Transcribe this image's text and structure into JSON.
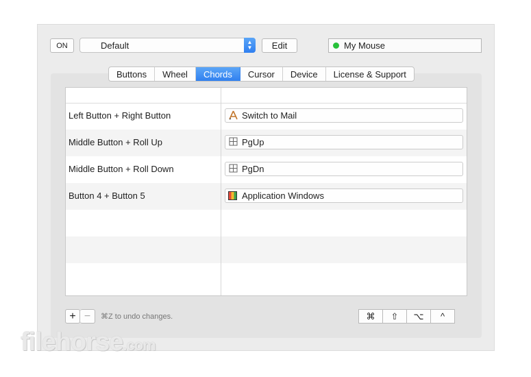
{
  "toolbar": {
    "on_label": "ON",
    "preset": "Default",
    "edit_label": "Edit",
    "device_name": "My Mouse",
    "device_status_color": "#28c13b"
  },
  "tabs": [
    {
      "label": "Buttons",
      "active": false
    },
    {
      "label": "Wheel",
      "active": false
    },
    {
      "label": "Chords",
      "active": true
    },
    {
      "label": "Cursor",
      "active": false
    },
    {
      "label": "Device",
      "active": false
    },
    {
      "label": "License & Support",
      "active": false
    }
  ],
  "chords": [
    {
      "trigger": "Left Button + Right Button",
      "action": "Switch to Mail",
      "icon": "app-store-icon"
    },
    {
      "trigger": "Middle Button + Roll Up",
      "action": "PgUp",
      "icon": "keystroke-icon"
    },
    {
      "trigger": "Middle Button + Roll Down",
      "action": "PgDn",
      "icon": "keystroke-icon"
    },
    {
      "trigger": "Button 4 + Button 5",
      "action": "Application Windows",
      "icon": "app-windows-icon"
    }
  ],
  "footer": {
    "add_label": "+",
    "remove_label": "−",
    "undo_hint": "⌘Z to undo changes.",
    "modifiers": [
      "⌘",
      "⇧",
      "⌥",
      "^"
    ]
  },
  "watermark": {
    "brand": "filehorse",
    "suffix": ".com"
  },
  "accent_color": "#3080ef"
}
